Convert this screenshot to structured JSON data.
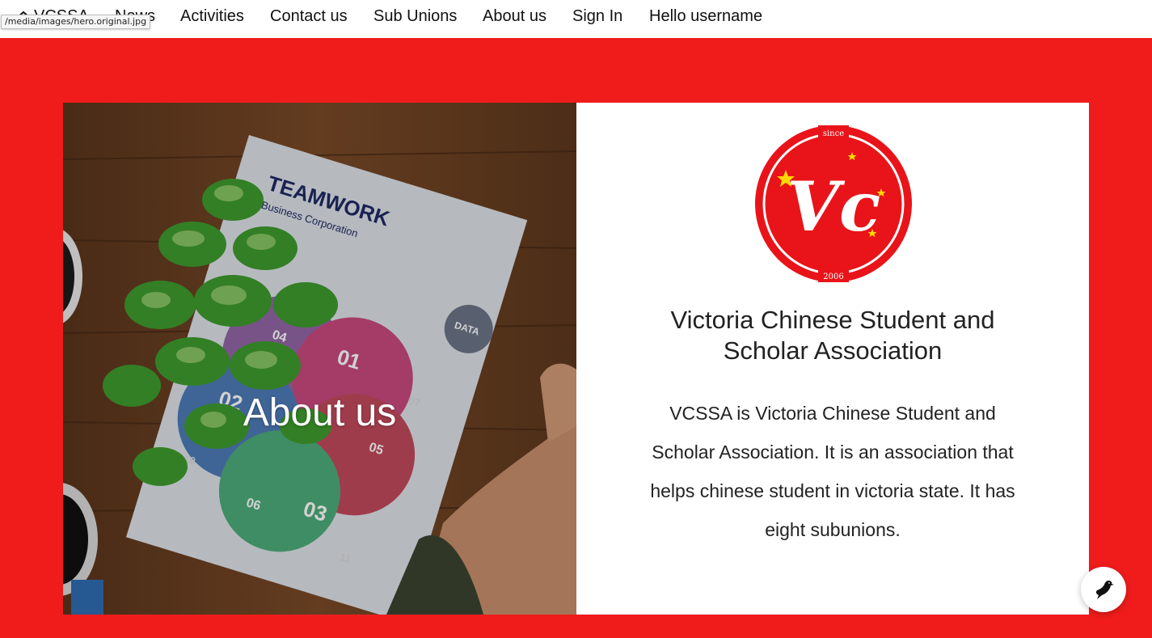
{
  "nav": {
    "brand_label": "VCSSA",
    "items": [
      {
        "label": "News"
      },
      {
        "label": "Activities"
      },
      {
        "label": "Contact us"
      },
      {
        "label": "Sub Unions"
      },
      {
        "label": "About us"
      },
      {
        "label": "Sign In"
      },
      {
        "label": "Hello username"
      }
    ]
  },
  "tooltip": {
    "url": "/media/images/hero.original.jpg"
  },
  "hero": {
    "title": "About us",
    "image_text": {
      "teamwork": "TEAMWORK",
      "corp": "Business Corporation",
      "data": "DATA",
      "n01": "01",
      "n02": "02",
      "n03": "03",
      "n04": "04",
      "n05": "05",
      "n06": "06",
      "n07": "07",
      "n10": "10",
      "n11": "11"
    }
  },
  "logo": {
    "top_text": "since",
    "monogram": "Vc",
    "bottom_text": "2006"
  },
  "card": {
    "title": "Victoria Chinese Student and Scholar Association",
    "description": "VCSSA is Victoria Chinese Student and Scholar Association. It is an association that helps chinese student in victoria state. It has eight subunions."
  },
  "colors": {
    "brand_red": "#f01c1c",
    "logo_red": "#e8141a",
    "star_yellow": "#ffd700"
  },
  "icons": {
    "home": "home-icon",
    "fab": "bird-icon"
  }
}
